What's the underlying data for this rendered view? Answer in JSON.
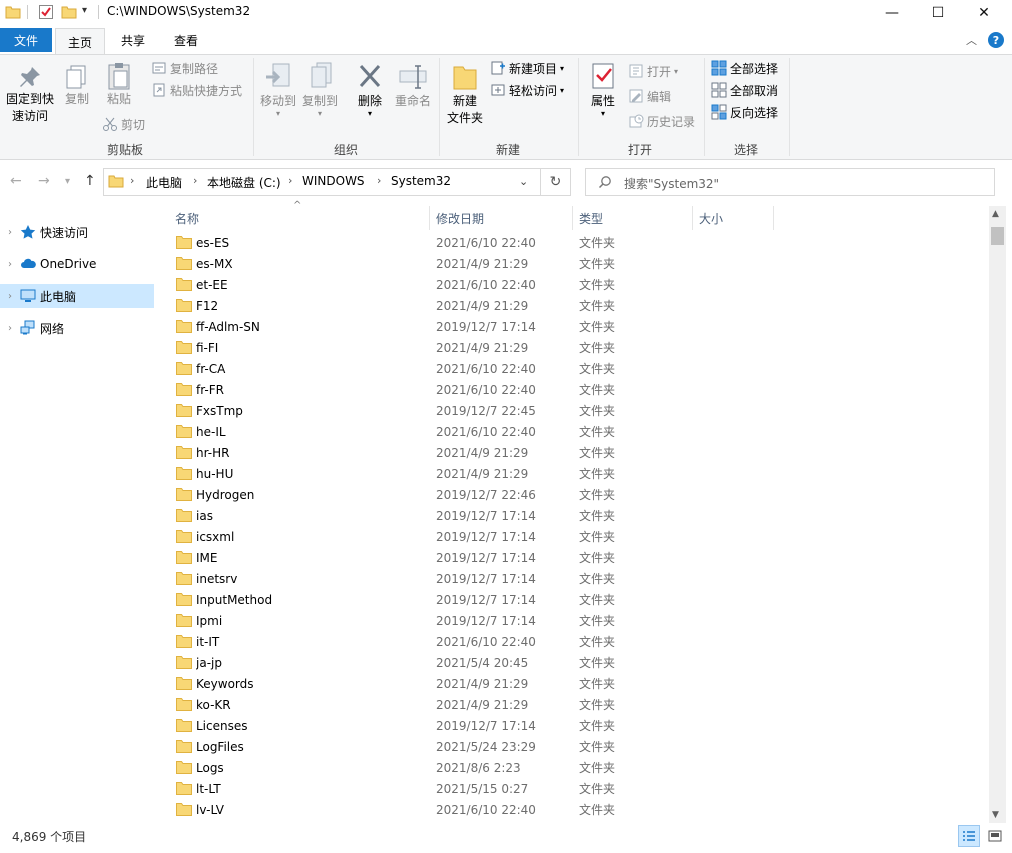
{
  "window": {
    "path": "C:\\WINDOWS\\System32",
    "minimize_glyph": "—",
    "maximize_glyph": "☐",
    "close_glyph": "✕"
  },
  "tabs": {
    "file": "文件",
    "home": "主页",
    "share": "共享",
    "view": "查看"
  },
  "ribbon": {
    "clipboard": {
      "pin_line1": "固定到快",
      "pin_line2": "速访问",
      "copy": "复制",
      "paste": "粘贴",
      "copy_path": "复制路径",
      "paste_shortcut": "粘贴快捷方式",
      "cut": "剪切",
      "group": "剪贴板"
    },
    "organize": {
      "move_to": "移动到",
      "copy_to": "复制到",
      "delete": "删除",
      "rename": "重命名",
      "group": "组织"
    },
    "new": {
      "new_folder_line1": "新建",
      "new_folder_line2": "文件夹",
      "new_item": "新建项目",
      "easy_access": "轻松访问",
      "group": "新建"
    },
    "open": {
      "properties": "属性",
      "open": "打开",
      "edit": "编辑",
      "history": "历史记录",
      "group": "打开"
    },
    "select": {
      "select_all": "全部选择",
      "select_none": "全部取消",
      "invert": "反向选择",
      "group": "选择"
    }
  },
  "address": {
    "crumbs": [
      "此电脑",
      "本地磁盘 (C:)",
      "WINDOWS",
      "System32"
    ],
    "search_placeholder": "搜索\"System32\""
  },
  "nav": {
    "items": [
      {
        "label": "快速访问"
      },
      {
        "label": "OneDrive"
      },
      {
        "label": "此电脑"
      },
      {
        "label": "网络"
      }
    ]
  },
  "columns": {
    "name": "名称",
    "date": "修改日期",
    "type": "类型",
    "size": "大小"
  },
  "files": [
    {
      "name": "es-ES",
      "date": "2021/6/10 22:40",
      "type": "文件夹"
    },
    {
      "name": "es-MX",
      "date": "2021/4/9 21:29",
      "type": "文件夹"
    },
    {
      "name": "et-EE",
      "date": "2021/6/10 22:40",
      "type": "文件夹"
    },
    {
      "name": "F12",
      "date": "2021/4/9 21:29",
      "type": "文件夹"
    },
    {
      "name": "ff-Adlm-SN",
      "date": "2019/12/7 17:14",
      "type": "文件夹"
    },
    {
      "name": "fi-FI",
      "date": "2021/4/9 21:29",
      "type": "文件夹"
    },
    {
      "name": "fr-CA",
      "date": "2021/6/10 22:40",
      "type": "文件夹"
    },
    {
      "name": "fr-FR",
      "date": "2021/6/10 22:40",
      "type": "文件夹"
    },
    {
      "name": "FxsTmp",
      "date": "2019/12/7 22:45",
      "type": "文件夹"
    },
    {
      "name": "he-IL",
      "date": "2021/6/10 22:40",
      "type": "文件夹"
    },
    {
      "name": "hr-HR",
      "date": "2021/4/9 21:29",
      "type": "文件夹"
    },
    {
      "name": "hu-HU",
      "date": "2021/4/9 21:29",
      "type": "文件夹"
    },
    {
      "name": "Hydrogen",
      "date": "2019/12/7 22:46",
      "type": "文件夹"
    },
    {
      "name": "ias",
      "date": "2019/12/7 17:14",
      "type": "文件夹"
    },
    {
      "name": "icsxml",
      "date": "2019/12/7 17:14",
      "type": "文件夹"
    },
    {
      "name": "IME",
      "date": "2019/12/7 17:14",
      "type": "文件夹"
    },
    {
      "name": "inetsrv",
      "date": "2019/12/7 17:14",
      "type": "文件夹"
    },
    {
      "name": "InputMethod",
      "date": "2019/12/7 17:14",
      "type": "文件夹"
    },
    {
      "name": "Ipmi",
      "date": "2019/12/7 17:14",
      "type": "文件夹"
    },
    {
      "name": "it-IT",
      "date": "2021/6/10 22:40",
      "type": "文件夹"
    },
    {
      "name": "ja-jp",
      "date": "2021/5/4 20:45",
      "type": "文件夹"
    },
    {
      "name": "Keywords",
      "date": "2021/4/9 21:29",
      "type": "文件夹"
    },
    {
      "name": "ko-KR",
      "date": "2021/4/9 21:29",
      "type": "文件夹"
    },
    {
      "name": "Licenses",
      "date": "2019/12/7 17:14",
      "type": "文件夹"
    },
    {
      "name": "LogFiles",
      "date": "2021/5/24 23:29",
      "type": "文件夹"
    },
    {
      "name": "Logs",
      "date": "2021/8/6 2:23",
      "type": "文件夹"
    },
    {
      "name": "lt-LT",
      "date": "2021/5/15 0:27",
      "type": "文件夹"
    },
    {
      "name": "lv-LV",
      "date": "2021/6/10 22:40",
      "type": "文件夹"
    }
  ],
  "status": {
    "item_count": "4,869 个项目"
  },
  "colors": {
    "accent": "#1979ca",
    "folder": "#f8d775",
    "selection": "#cce8ff"
  }
}
